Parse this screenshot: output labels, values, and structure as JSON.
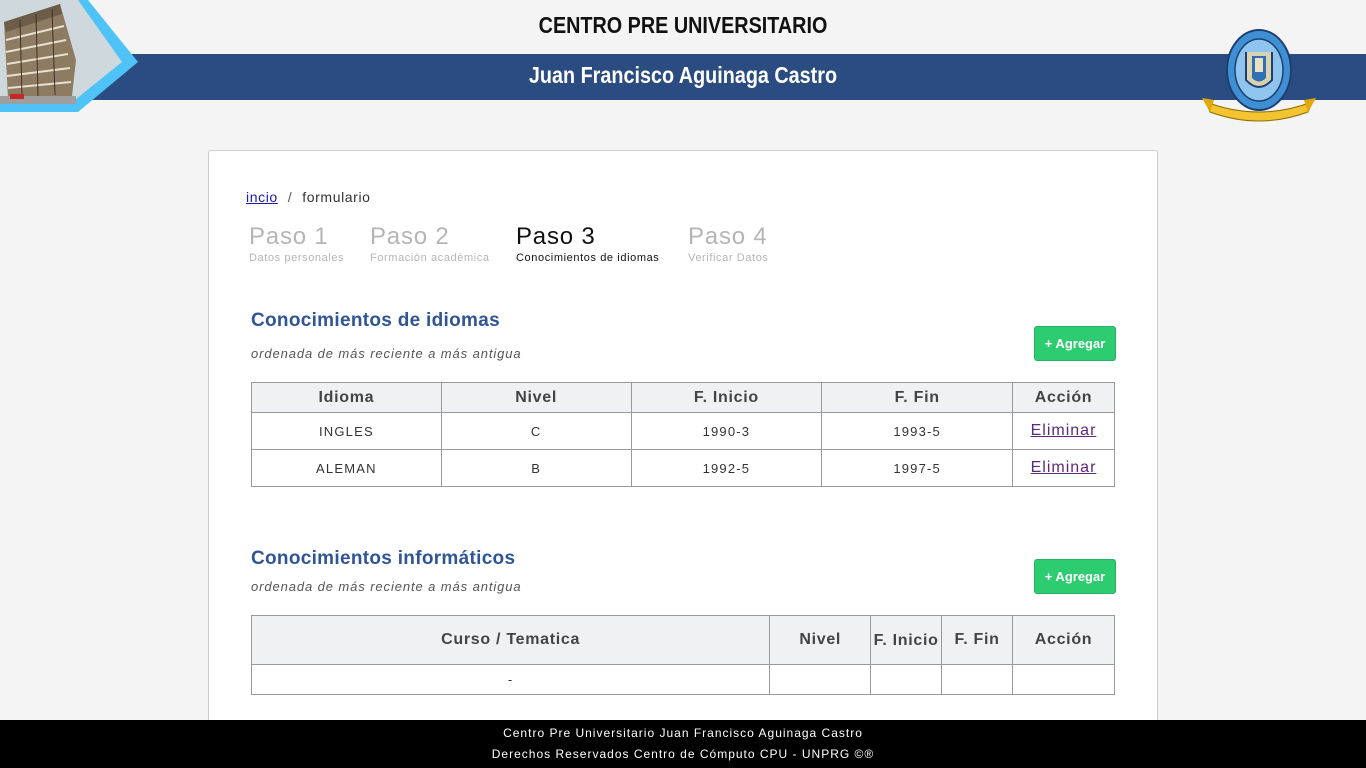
{
  "header": {
    "title": "CENTRO PRE UNIVERSITARIO",
    "subtitle": "Juan Francisco Aguinaga Castro",
    "logo_icon": "university-seal-icon",
    "building_icon": "building-photo-icon",
    "band_color": "#2b4c80"
  },
  "breadcrumb": {
    "home": "incio",
    "separator": "/",
    "current": "formulario"
  },
  "steps": [
    {
      "num": "Paso 1",
      "label": "Datos personales",
      "active": false
    },
    {
      "num": "Paso 2",
      "label": "Formación académica",
      "active": false
    },
    {
      "num": "Paso 3",
      "label": "Conocimientos de idiomas",
      "active": true
    },
    {
      "num": "Paso 4",
      "label": "Verificar Datos",
      "active": false
    }
  ],
  "languages": {
    "title": "Conocimientos de idiomas",
    "subtitle": "ordenada de más reciente a más antigua",
    "add_label": "+ Agregar",
    "columns": [
      "Idioma",
      "Nivel",
      "F. Inicio",
      "F. Fin",
      "Acción"
    ],
    "rows": [
      {
        "idioma": "INGLES",
        "nivel": "C",
        "inicio": "1990-3",
        "fin": "1993-5",
        "accion": "Eliminar"
      },
      {
        "idioma": "ALEMAN",
        "nivel": "B",
        "inicio": "1992-5",
        "fin": "1997-5",
        "accion": "Eliminar"
      }
    ]
  },
  "computing": {
    "title": "Conocimientos informáticos",
    "subtitle": "ordenada de más reciente a más antigua",
    "add_label": "+ Agregar",
    "columns": [
      "Curso / Tematica",
      "Nivel",
      "F. Inicio",
      "F. Fin",
      "Acción"
    ],
    "rows": [
      {
        "curso": "-",
        "nivel": "",
        "inicio": "",
        "fin": "",
        "accion": ""
      }
    ]
  },
  "footer": {
    "line1": "Centro Pre Universitario Juan Francisco Aguinaga Castro",
    "line2": "Derechos Reservados Centro de Cómputo CPU - UNPRG ©®"
  },
  "colors": {
    "accent_green": "#2ecc71",
    "section_title": "#2f5597"
  }
}
